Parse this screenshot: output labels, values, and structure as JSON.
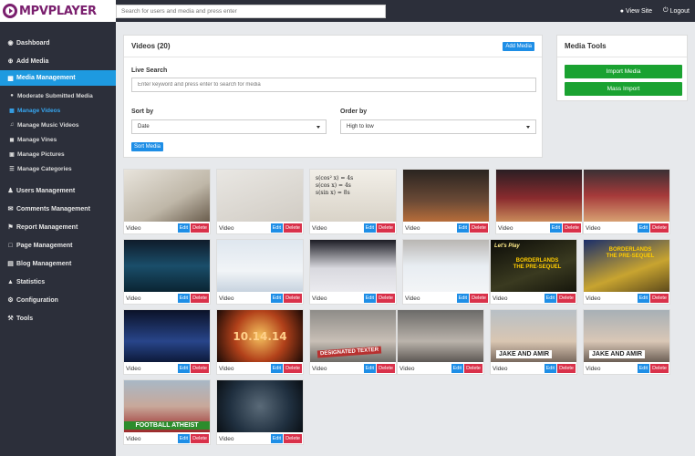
{
  "header": {
    "logo_text": "MPVPLAYER",
    "search_placeholder": "Search for users and media and press enter",
    "view_site": "View Site",
    "logout": "Logout"
  },
  "sidebar": {
    "items": [
      {
        "label": "Dashboard",
        "icon": "palette-icon"
      },
      {
        "label": "Add Media",
        "icon": "plus-circle-icon"
      },
      {
        "label": "Media Management",
        "icon": "film-icon",
        "active": true
      },
      {
        "label": "Users Management",
        "icon": "user-icon"
      },
      {
        "label": "Comments Management",
        "icon": "comments-icon"
      },
      {
        "label": "Report Management",
        "icon": "flag-icon"
      },
      {
        "label": "Page Management",
        "icon": "file-icon"
      },
      {
        "label": "Blog Management",
        "icon": "book-icon"
      },
      {
        "label": "Statistics",
        "icon": "chart-icon"
      },
      {
        "label": "Configuration",
        "icon": "gear-icon"
      },
      {
        "label": "Tools",
        "icon": "wrench-icon"
      }
    ],
    "subitems": [
      {
        "label": "Moderate Submitted Media",
        "icon": "dot-icon"
      },
      {
        "label": "Manage Videos",
        "icon": "film-icon",
        "current": true
      },
      {
        "label": "Manage Music Videos",
        "icon": "music-icon"
      },
      {
        "label": "Manage Vines",
        "icon": "video-camera-icon"
      },
      {
        "label": "Manage Pictures",
        "icon": "picture-icon"
      },
      {
        "label": "Manage Categories",
        "icon": "list-icon"
      }
    ]
  },
  "videos_panel": {
    "title": "Videos (20)",
    "add_media": "Add Media",
    "live_search_label": "Live Search",
    "live_search_placeholder": "Enter keyword and press enter to search for media",
    "sort_by_label": "Sort by",
    "sort_by_value": "Date",
    "order_by_label": "Order by",
    "order_by_value": "High to low",
    "sort_button": "Sort Media"
  },
  "tools_panel": {
    "title": "Media Tools",
    "import_media": "Import Media",
    "mass_import": "Mass Import"
  },
  "grid": {
    "type_label": "Video",
    "edit_label": "Edit",
    "delete_label": "Delete",
    "overlays": {
      "math1": "s(cos² x) = 4s\ns(cos x) = 4s\ns(sin x) = 8s",
      "date": "10.14.14",
      "lets_play": "Let's Play",
      "bl": "BORDERLANDS\nTHE PRE-SEQUEL",
      "designated": "DESIGNATED TEXTER",
      "jake": "JAKE AND AMIR",
      "football": "FOOTBALL ATHEIST"
    }
  }
}
